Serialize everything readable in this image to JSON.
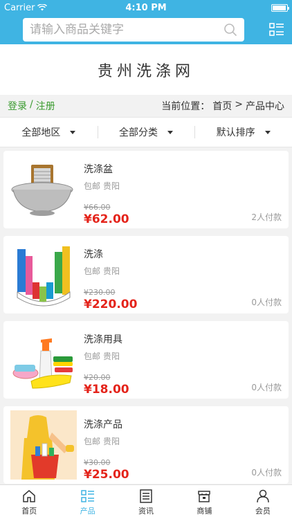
{
  "status": {
    "carrier": "Carrier",
    "time": "4:10 PM",
    "battery_level": 0.95
  },
  "search": {
    "placeholder": "请输入商品关键字"
  },
  "brand": {
    "title": "贵州洗涤网"
  },
  "auth": {
    "login": "登录",
    "separator": "/",
    "register": "注册"
  },
  "breadcrumb": {
    "label": "当前位置：",
    "home": "首页",
    "arrow": ">",
    "current": "产品中心"
  },
  "filters": [
    {
      "label": "全部地区"
    },
    {
      "label": "全部分类"
    },
    {
      "label": "默认排序"
    }
  ],
  "products": [
    {
      "name": "洗涤盆",
      "shipping": "包邮",
      "location": "贵阳",
      "old_price": "¥66.00",
      "price": "¥62.00",
      "sold": "2人付款",
      "image": "washboard-basin"
    },
    {
      "name": "洗涤",
      "shipping": "包邮",
      "location": "贵阳",
      "old_price": "¥230.00",
      "price": "¥220.00",
      "sold": "0人付款",
      "image": "detergent-bottles"
    },
    {
      "name": "洗涤用具",
      "shipping": "包邮",
      "location": "贵阳",
      "old_price": "¥20.00",
      "price": "¥18.00",
      "sold": "0人付款",
      "image": "cleaning-tools"
    },
    {
      "name": "洗涤产品",
      "shipping": "包邮",
      "location": "贵阳",
      "old_price": "¥30.00",
      "price": "¥25.00",
      "sold": "0人付款",
      "image": "cleaner-with-bucket"
    }
  ],
  "tabs": [
    {
      "label": "首页",
      "icon": "home-icon",
      "active": false
    },
    {
      "label": "产品",
      "icon": "product-grid-icon",
      "active": true
    },
    {
      "label": "资讯",
      "icon": "news-icon",
      "active": false
    },
    {
      "label": "商铺",
      "icon": "shop-icon",
      "active": false
    },
    {
      "label": "会员",
      "icon": "member-icon",
      "active": false
    }
  ],
  "colors": {
    "accent": "#3fb4e3",
    "price": "#e4241b",
    "login": "#3a9b2f"
  }
}
